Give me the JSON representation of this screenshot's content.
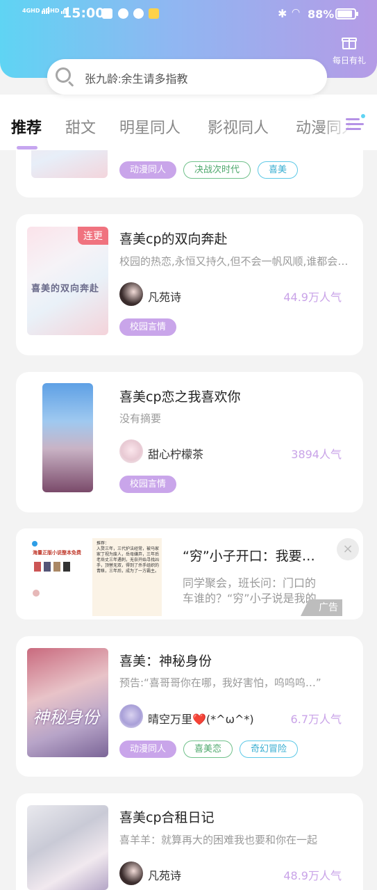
{
  "status_bar": {
    "network1": "4GHD",
    "network2": "4GHD",
    "time": "15:00",
    "battery": "88%",
    "bluetooth_icon": "bluetooth-icon",
    "wifi_icon": "wifi-icon"
  },
  "header": {
    "gift_label": "每日有礼",
    "search_placeholder": "张九龄:余生请多指教"
  },
  "tabs": [
    {
      "label": "推荐",
      "active": true
    },
    {
      "label": "甜文"
    },
    {
      "label": "明星同人"
    },
    {
      "label": "影视同人"
    },
    {
      "label": "动漫同人"
    }
  ],
  "cards": [
    {
      "tags": [
        "动漫同人",
        "决战次时代",
        "喜美"
      ]
    },
    {
      "badge": "连更",
      "title": "喜美cp的双向奔赴",
      "desc": "校园的热恋,永恒又持久,但不会一帆风顺,谁都会有坎坷",
      "author": "凡苑诗",
      "popularity": "44.9万人气",
      "tags": [
        "校园言情"
      ]
    },
    {
      "title": "喜美cp恋之我喜欢你",
      "desc": "没有摘要",
      "author": "甜心柠檬茶",
      "popularity": "3894人气",
      "tags": [
        "校园言情"
      ]
    },
    {
      "title": "喜美：神秘身份",
      "desc": "预告:“喜哥哥你在哪，我好害怕，呜呜呜…”",
      "author": "晴空万里❤️(*^ω^*)",
      "popularity": "6.7万人气",
      "tags": [
        "动漫同人",
        "喜美恋",
        "奇幻冒险"
      ]
    },
    {
      "title": "喜美cp合租日记",
      "desc": "喜羊羊：就算再大的困难我也要和你在一起",
      "author": "凡苑诗",
      "popularity": "48.9万人气"
    }
  ],
  "ad": {
    "title": "“穷”小子开口：我要买下这家公司",
    "desc": "同学聚会，班长问：门口的车谁的？“穷”小子说是我的",
    "label": "广告",
    "close": "×",
    "image_text": {
      "heading": "海量正版小说整本免费",
      "intro": "推荐：",
      "body": "入赘三年，三代护法经常，被马家家丁视为废人，岳母嫌弃，三年后老岳丈三年遇刺，无奈开始寻找凶手，顶替无双，得到了杀手组织的青睐，三年后，成为了一方霸主。"
    }
  },
  "colors": {
    "accent_purple": "#c9a5ea",
    "header_start": "#5fd4f3",
    "header_end": "#b59be6"
  }
}
